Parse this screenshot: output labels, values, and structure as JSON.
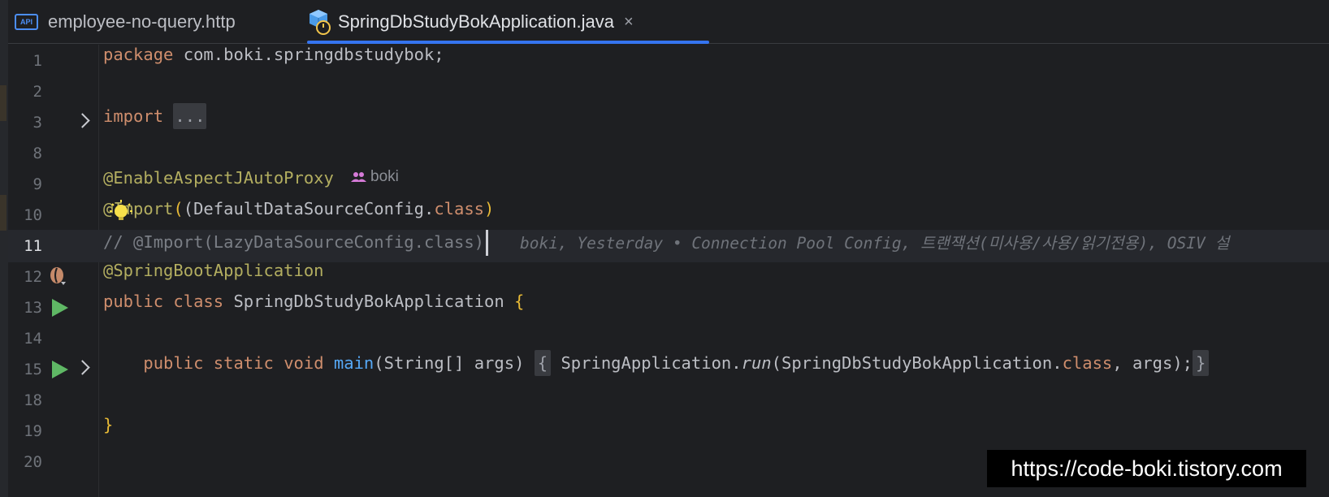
{
  "tabs": [
    {
      "label": "employee-no-query.http",
      "icon": "api-file-icon",
      "active": false
    },
    {
      "label": "SpringDbStudyBokApplication.java",
      "icon": "spring-boot-java-icon",
      "active": true,
      "close": "×"
    }
  ],
  "lines": {
    "l1": {
      "num": "1",
      "kw": "package",
      "rest": " com.boki.springdbstudybok;"
    },
    "l2": {
      "num": "2"
    },
    "l3": {
      "num": "3",
      "kw": "import",
      "fold": "..."
    },
    "l8": {
      "num": "8"
    },
    "l9": {
      "num": "9",
      "ann": "@EnableAspectJAutoProxy",
      "author": "boki"
    },
    "l10": {
      "num": "10",
      "ann_at": "@",
      "ann_rest": "Import",
      "p1": "(DefaultDataSourceConfig.",
      "kw": "class",
      "p2": ")"
    },
    "l11": {
      "num": "11",
      "comment": "// @Import(LazyDataSourceConfig.class)",
      "blame": "boki, Yesterday • Connection Pool Config, 트랜잭션(미사용/사용/읽기전용), OSIV 설"
    },
    "l12": {
      "num": "12",
      "ann": "@SpringBootApplication"
    },
    "l13": {
      "num": "13",
      "kw1": "public",
      "kw2": "class",
      "name": " SpringDbStudyBokApplication ",
      "brace": "{"
    },
    "l14": {
      "num": "14"
    },
    "l15": {
      "num": "15",
      "indent": "    ",
      "kw1": "public",
      "kw2": "static",
      "kw3": "void",
      "fn": "main",
      "params": "(String[] args)",
      "ob": "{",
      "cls": " SpringApplication.",
      "run": "run",
      "args1": "(SpringDbStudyBokApplication.",
      "kw4": "class",
      "args2": ", args);",
      "cb": "}"
    },
    "l18": {
      "num": "18"
    },
    "l19": {
      "num": "19",
      "brace": "}"
    },
    "l20": {
      "num": "20"
    }
  },
  "gutter_icons": [
    "fold-chevron-icon",
    "lightbulb-icon",
    "spring-bean-icon",
    "run-icon",
    "run-icon"
  ],
  "watermark": "https://code-boki.tistory.com",
  "colors": {
    "keyword": "#cf8e6d",
    "annotation": "#b3ae60",
    "function": "#56a8f5",
    "comment": "#7a7e85",
    "brace": "#e8ba36",
    "background": "#1e1f22",
    "accent": "#3574f0"
  }
}
